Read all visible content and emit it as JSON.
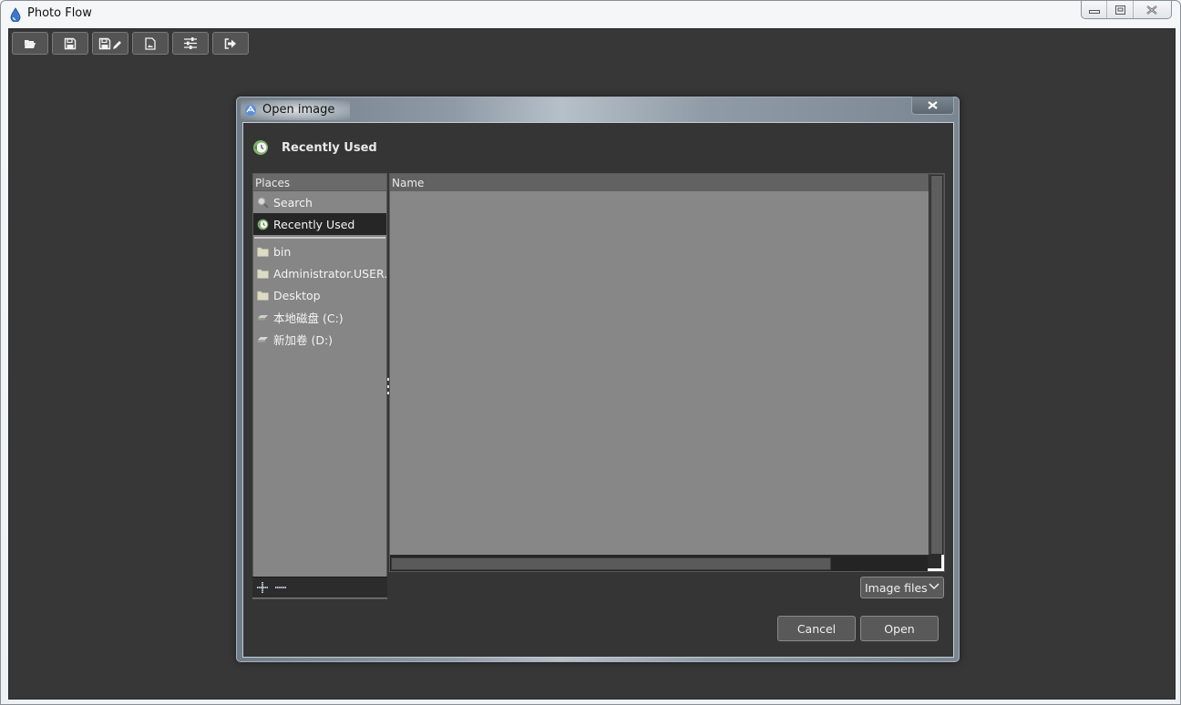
{
  "window": {
    "title": "Photo Flow",
    "app_icon": "water-drop-icon",
    "controls": [
      "minimize",
      "maximize",
      "close"
    ]
  },
  "toolbar": {
    "buttons": [
      {
        "name": "open",
        "icon": "folder-open-icon"
      },
      {
        "name": "save",
        "icon": "floppy-disk-icon"
      },
      {
        "name": "save-as",
        "icon": "floppy-disk-pencil-icon"
      },
      {
        "name": "export",
        "icon": "image-file-icon"
      },
      {
        "name": "settings",
        "icon": "sliders-icon"
      },
      {
        "name": "exit",
        "icon": "sign-out-icon"
      }
    ]
  },
  "dialog": {
    "title": "Open image",
    "close_label": "×",
    "location": {
      "icon": "recently-used-icon",
      "label": "Recently Used"
    },
    "places": {
      "header": "Places",
      "items": [
        {
          "label": "Search",
          "icon": "search-icon",
          "selected": false
        },
        {
          "label": "Recently Used",
          "icon": "recently-used-icon",
          "selected": true
        }
      ],
      "bookmarks": [
        {
          "label": "bin",
          "icon": "folder-icon"
        },
        {
          "label": "Administrator.USER...",
          "icon": "folder-icon"
        },
        {
          "label": "Desktop",
          "icon": "folder-icon"
        },
        {
          "label": "本地磁盘 (C:)",
          "icon": "drive-icon"
        },
        {
          "label": "新加卷 (D:)",
          "icon": "drive-icon"
        }
      ],
      "footer": {
        "add_icon": "plus-icon",
        "remove_icon": "minus-icon"
      }
    },
    "files": {
      "column_header": "Name",
      "rows": []
    },
    "filter": {
      "selected": "Image files"
    },
    "buttons": {
      "cancel": "Cancel",
      "open": "Open"
    }
  }
}
